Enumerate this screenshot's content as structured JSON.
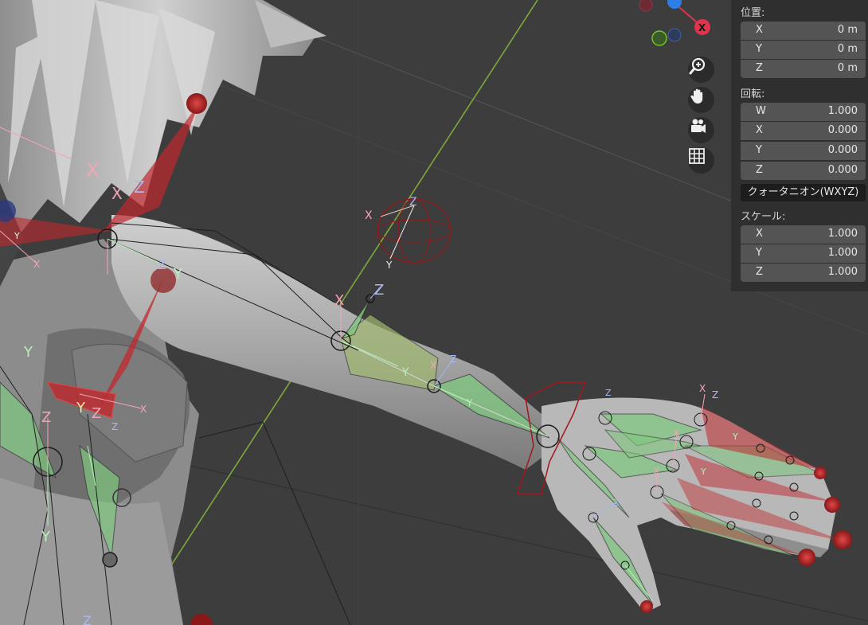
{
  "gizmo": {
    "x_label": "X",
    "x_color": "#e0344d",
    "y_color": "#73c52a",
    "z_color": "#2d7ee6"
  },
  "nav_buttons": [
    {
      "name": "zoom-button",
      "icon": "zoom-in-icon"
    },
    {
      "name": "pan-button",
      "icon": "hand-icon"
    },
    {
      "name": "camera-view-button",
      "icon": "camera-icon"
    },
    {
      "name": "ortho-toggle-button",
      "icon": "grid-icon"
    }
  ],
  "panel": {
    "location": {
      "label": "位置:",
      "fields": [
        {
          "axis": "X",
          "value": "0 m"
        },
        {
          "axis": "Y",
          "value": "0 m"
        },
        {
          "axis": "Z",
          "value": "0 m"
        }
      ]
    },
    "rotation": {
      "label": "回転:",
      "fields": [
        {
          "axis": "W",
          "value": "1.000"
        },
        {
          "axis": "X",
          "value": "0.000"
        },
        {
          "axis": "Y",
          "value": "0.000"
        },
        {
          "axis": "Z",
          "value": "0.000"
        }
      ],
      "mode": "クォータニオン(WXYZ)"
    },
    "scale": {
      "label": "スケール:",
      "fields": [
        {
          "axis": "X",
          "value": "1.000"
        },
        {
          "axis": "Y",
          "value": "1.000"
        },
        {
          "axis": "Z",
          "value": "1.000"
        }
      ]
    }
  },
  "bone_axis_labels": {
    "x": "X",
    "y": "Y",
    "z": "Z"
  },
  "colors": {
    "viewport_bg": "#3d3d3d",
    "panel_bg": "#2f2f2f",
    "field_bg": "#545454",
    "bone_green": "#7fc87f",
    "bone_red": "#c0282d"
  }
}
